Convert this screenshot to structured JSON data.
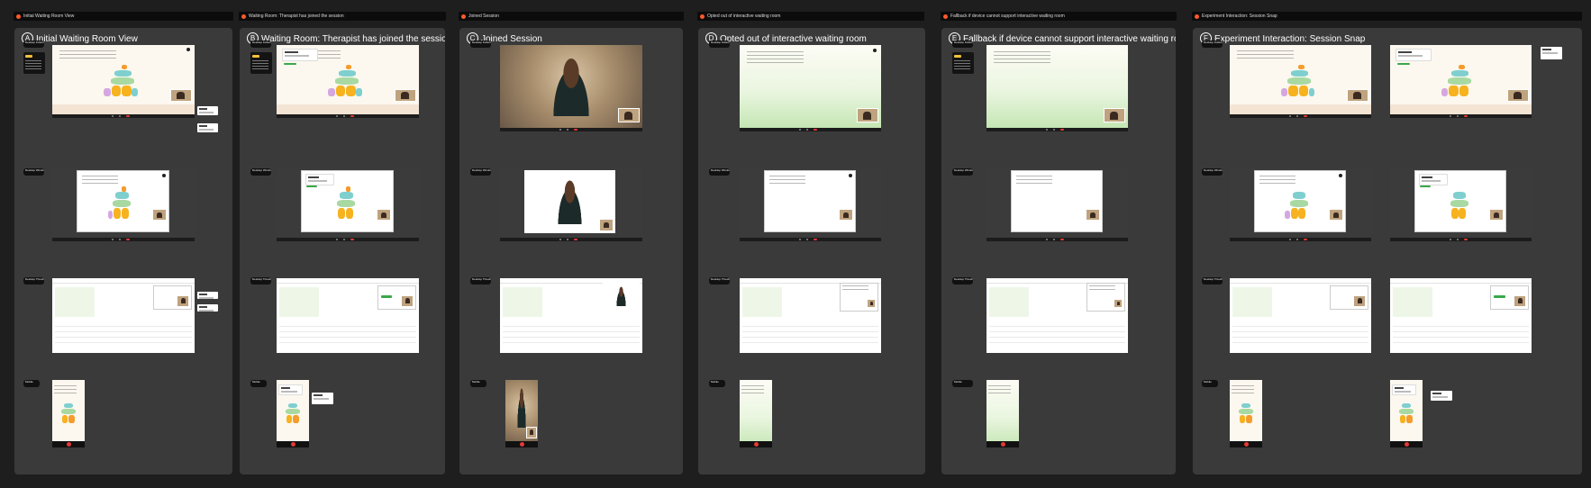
{
  "top_labels": [
    "Initial Waiting Room View",
    "Waiting Room: Therapist has joined the session",
    "Joined Session",
    "Opted out of interactive waiting room",
    "Fallback if device cannot support interactive waiting room",
    "Experiment Interaction: Session Snap"
  ],
  "sections": [
    {
      "letter": "A",
      "title": "Initial Waiting Room View"
    },
    {
      "letter": "B",
      "title": "Waiting Room: Therapist has joined the session"
    },
    {
      "letter": "C",
      "title": "Joined Session"
    },
    {
      "letter": "D",
      "title": "Opted out of interactive waiting room"
    },
    {
      "letter": "E",
      "title": "Fallback if device cannot support interactive waiting room"
    },
    {
      "letter": "F",
      "title": "Experiment Interaction: Session Snap"
    }
  ],
  "row_labels": [
    "Desktop Fullscreen",
    "Desktop Windowed",
    "Desktop Threshold",
    "Mobile"
  ],
  "colors": {
    "accent": "#ff5a2a",
    "cta_green": "#3aa84a",
    "cream": "#fcf8ef",
    "panel": "#3a3a3a"
  },
  "icons": [
    "record-dot-icon",
    "close-icon",
    "mic-icon",
    "camera-icon",
    "end-call-icon"
  ]
}
